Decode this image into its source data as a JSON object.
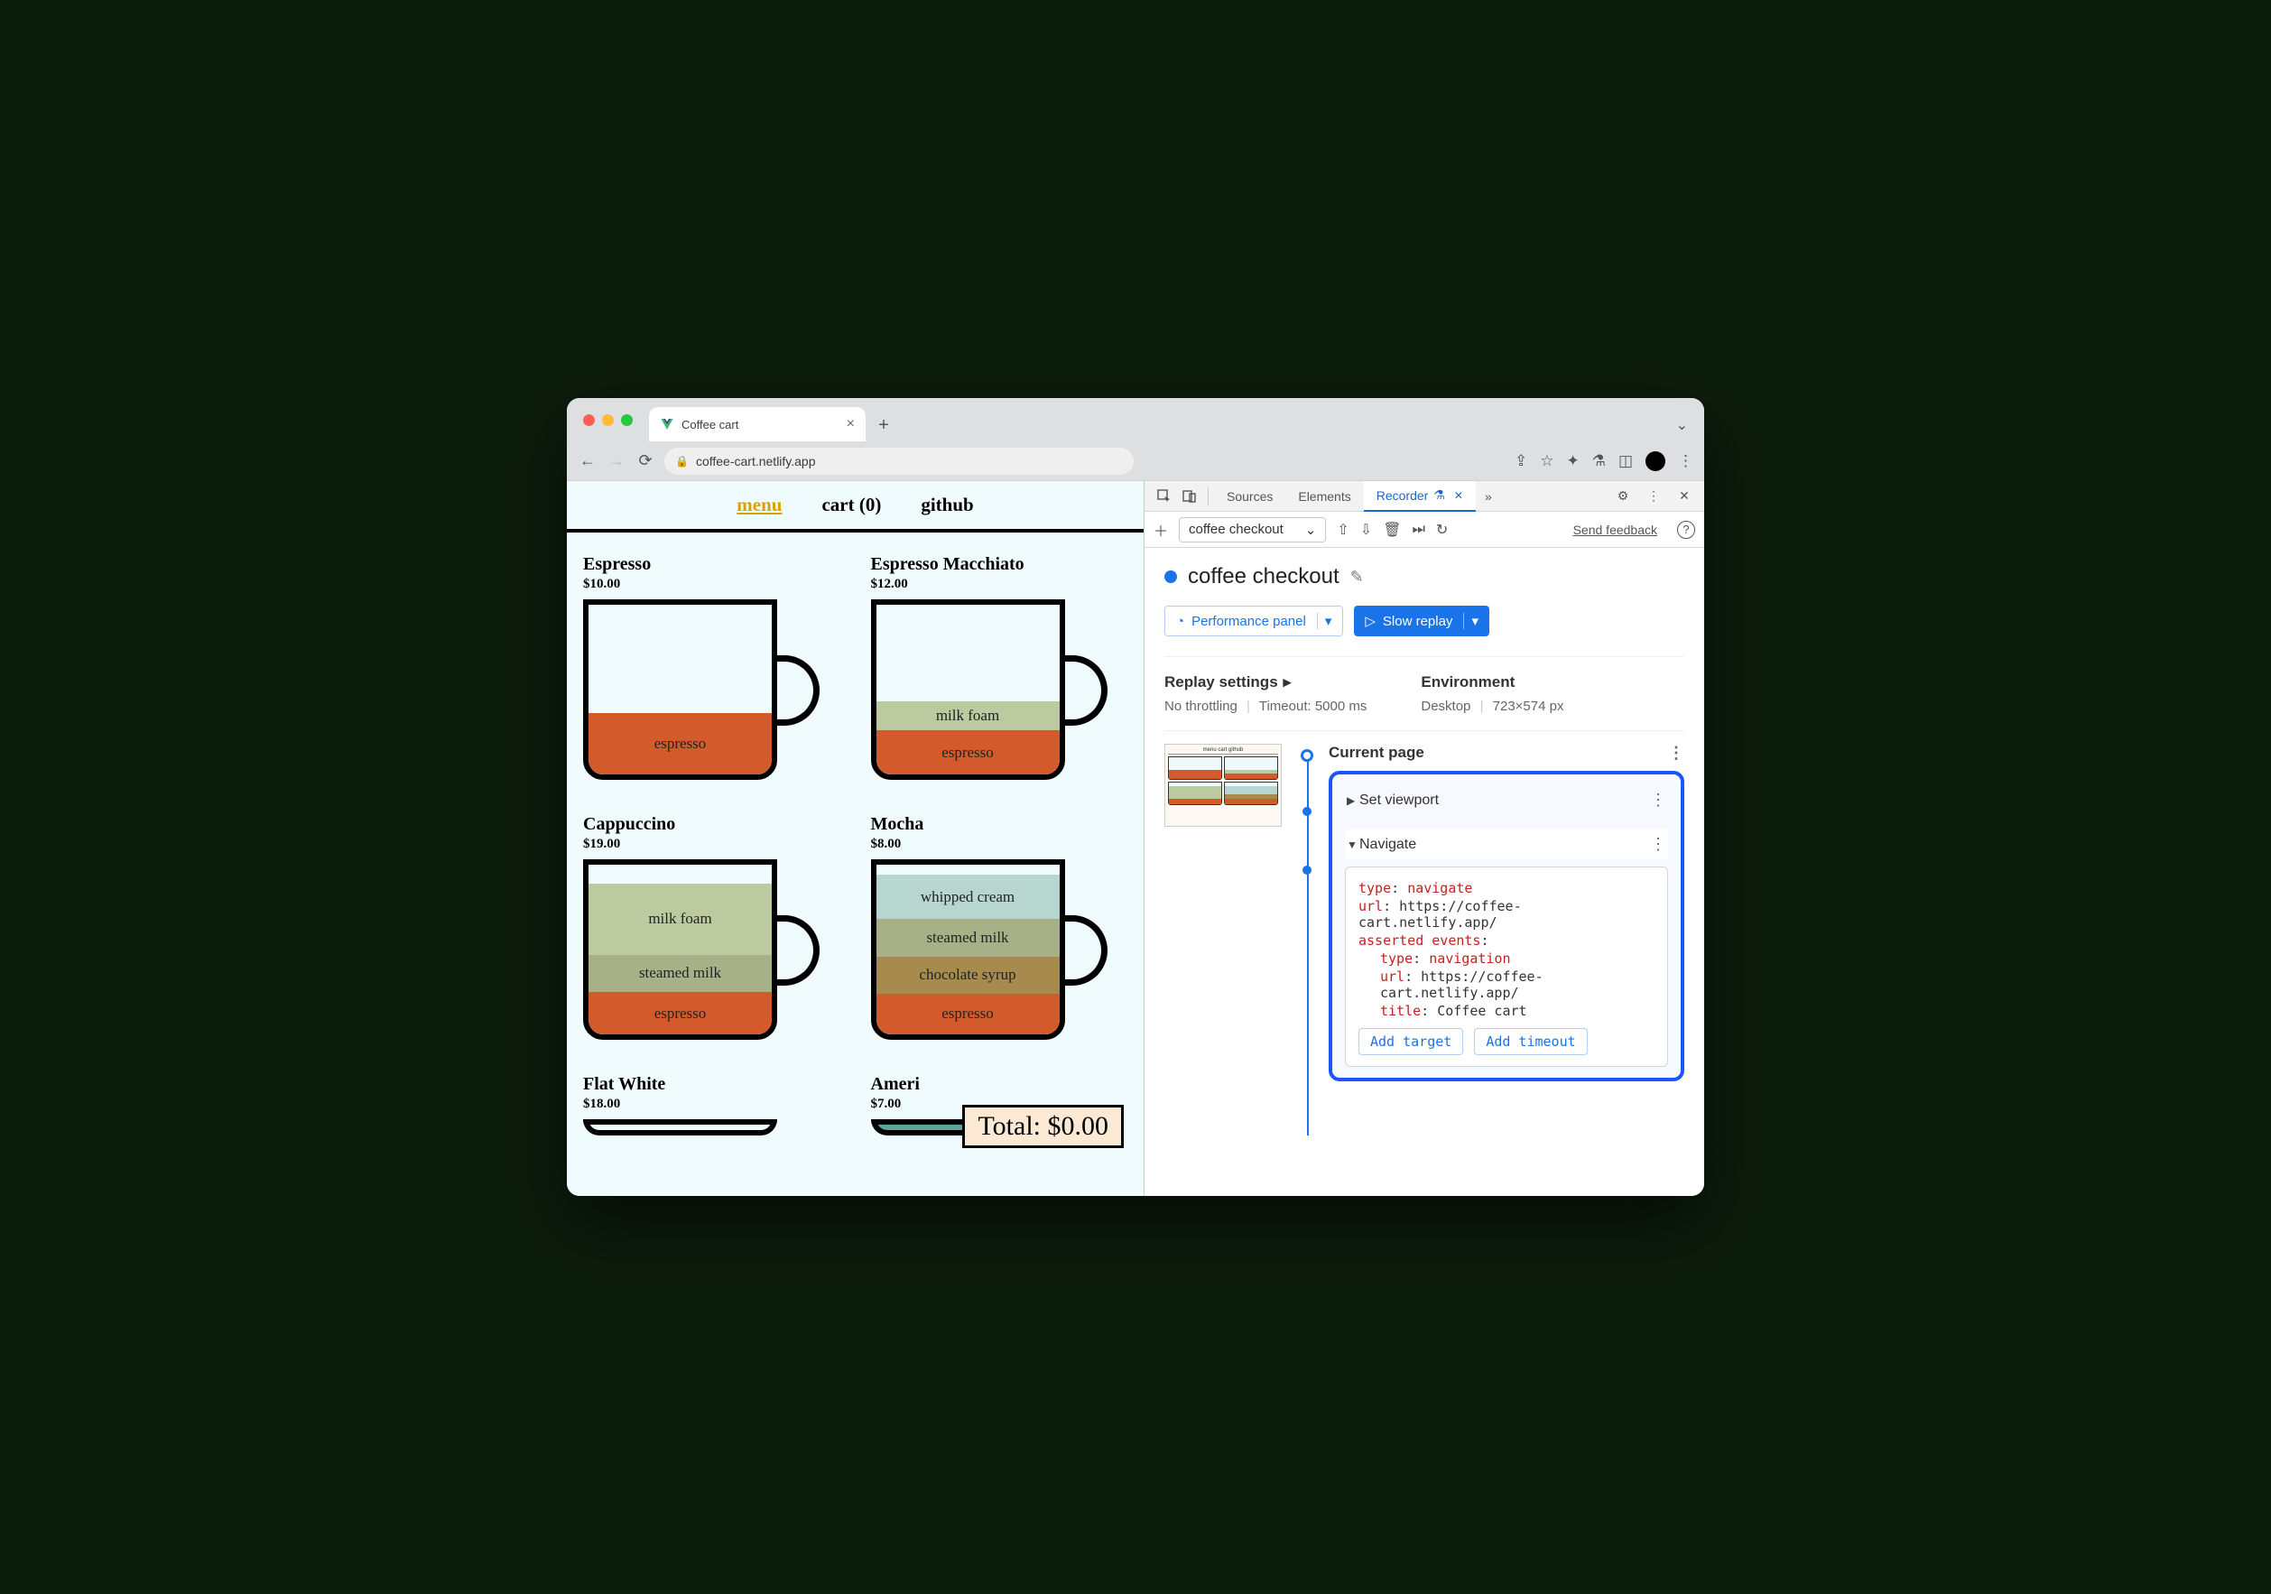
{
  "browser": {
    "tab_title": "Coffee cart",
    "url": "coffee-cart.netlify.app"
  },
  "page": {
    "nav": {
      "menu": "menu",
      "cart": "cart (0)",
      "github": "github"
    },
    "products": [
      {
        "name": "Espresso",
        "price": "$10.00"
      },
      {
        "name": "Espresso Macchiato",
        "price": "$12.00"
      },
      {
        "name": "Cappuccino",
        "price": "$19.00"
      },
      {
        "name": "Mocha",
        "price": "$8.00"
      },
      {
        "name": "Flat White",
        "price": "$18.00"
      },
      {
        "name": "Ameri",
        "price_partial": "$7.00"
      }
    ],
    "layers": {
      "espresso": "espresso",
      "milk_foam": "milk foam",
      "steamed_milk": "steamed milk",
      "whipped_cream": "whipped cream",
      "chocolate_syrup": "chocolate syrup"
    },
    "total_label": "Total: $0.00"
  },
  "devtools": {
    "tabs": {
      "sources": "Sources",
      "elements": "Elements",
      "recorder": "Recorder"
    },
    "toolbar": {
      "recording_name": "coffee checkout",
      "feedback": "Send feedback"
    },
    "title": "coffee checkout",
    "buttons": {
      "perf": "Performance panel",
      "replay": "Slow replay"
    },
    "settings": {
      "replay_h": "Replay settings",
      "throttling": "No throttling",
      "timeout": "Timeout: 5000 ms",
      "env_h": "Environment",
      "env_device": "Desktop",
      "env_vp": "723×574 px"
    },
    "steps": {
      "current": "Current page",
      "set_viewport": "Set viewport",
      "navigate": "Navigate",
      "code": {
        "type_k": "type",
        "type_v": "navigate",
        "url_k": "url",
        "url_v": "https://coffee-cart.netlify.app/",
        "ae_k": "asserted events",
        "nav_type_k": "type",
        "nav_type_v": "navigation",
        "nav_url_k": "url",
        "nav_url_v": "https://coffee-cart.netlify.app/",
        "title_k": "title",
        "title_v": "Coffee cart"
      },
      "add_target": "Add target",
      "add_timeout": "Add timeout"
    }
  }
}
